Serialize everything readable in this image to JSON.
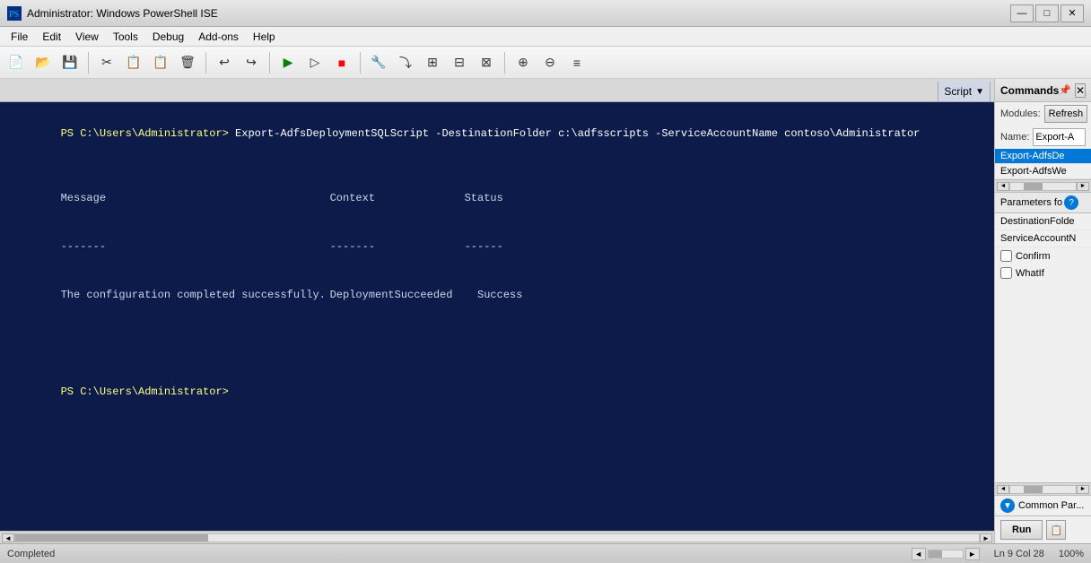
{
  "titleBar": {
    "icon": "ps",
    "title": "Administrator: Windows PowerShell ISE",
    "minimize": "—",
    "maximize": "□",
    "close": "✕"
  },
  "menuBar": {
    "items": [
      "File",
      "Edit",
      "View",
      "Tools",
      "Debug",
      "Add-ons",
      "Help"
    ]
  },
  "tabBar": {
    "tab": "Script"
  },
  "console": {
    "lines": [
      "PS C:\\Users\\Administrator> Export-AdfsDeploymentSQLScript -DestinationFolder c:\\adfsscripts -ServiceAccountName contoso\\Administrator",
      "",
      "Message                                    Context              Status",
      "-------                                    -------              ------",
      "The configuration completed successfully.  DeploymentSucceeded  Success",
      "",
      "",
      "",
      "PS C:\\Users\\Administrator>"
    ]
  },
  "commandsPanel": {
    "title": "Commands",
    "close": "✕",
    "modulesLabel": "Modules:",
    "refreshButton": "Refresh",
    "nameLabel": "Name:",
    "nameValue": "Export-A",
    "listItems": [
      {
        "label": "Export-AdfsDe",
        "selected": true
      },
      {
        "label": "Export-AdfsWe",
        "selected": false
      }
    ],
    "parametersHeader": "Parameters fo",
    "params": [
      "DestinationFolde",
      "ServiceAccountN"
    ],
    "checkboxes": [
      {
        "label": "Confirm",
        "checked": false
      },
      {
        "label": "WhatIf",
        "checked": false
      }
    ],
    "commonParams": "Common Par...",
    "runButton": "Run",
    "copyIcon": "📋"
  },
  "statusBar": {
    "text": "Completed",
    "position": "Ln 9  Col 28",
    "scroll": "",
    "zoom": "100%"
  }
}
